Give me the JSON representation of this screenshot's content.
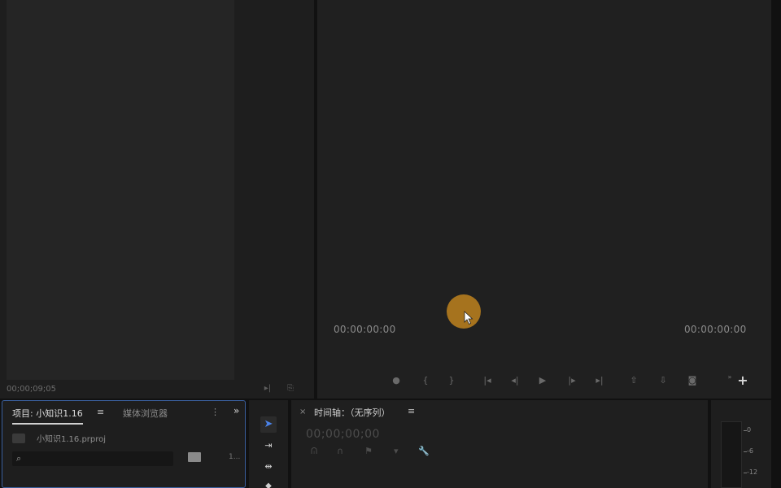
{
  "source_monitor": {
    "timecode": "00;00;09;05",
    "controls": [
      "export-frame-icon",
      "settings-icon"
    ]
  },
  "program_monitor": {
    "timecode_left": "00:00:00:00",
    "timecode_right": "00:00:00:00",
    "controls": [
      {
        "name": "add-marker-icon",
        "glyph": "●"
      },
      {
        "name": "mark-in-icon",
        "glyph": "{"
      },
      {
        "name": "mark-out-icon",
        "glyph": "}"
      },
      {
        "name": "go-to-in-icon",
        "glyph": "|◂"
      },
      {
        "name": "step-back-icon",
        "glyph": "◂|"
      },
      {
        "name": "play-icon",
        "glyph": "▶"
      },
      {
        "name": "step-forward-icon",
        "glyph": "|▸"
      },
      {
        "name": "go-to-out-icon",
        "glyph": "▸|"
      },
      {
        "name": "lift-icon",
        "glyph": "⇧"
      },
      {
        "name": "extract-icon",
        "glyph": "⇩"
      },
      {
        "name": "export-frame-icon",
        "glyph": "◙"
      }
    ],
    "more_label": "»",
    "add_label": "+"
  },
  "project_panel": {
    "tab_project": "项目: 小知识1.16",
    "tab_menu": "≡",
    "tab_media_browser": "媒体浏览器",
    "more": "⋮",
    "expand": "»",
    "file_name": "小知识1.16.prproj",
    "search_placeholder": "",
    "item_count": "1..."
  },
  "timeline_panel": {
    "close": "×",
    "title": "时间轴：（无序列）",
    "menu": "≡",
    "timecode": "00;00;00;00"
  },
  "audio_meter": {
    "labels": [
      "0",
      "-6",
      "-12"
    ]
  },
  "colors": {
    "accent_blue": "#3a5f9e",
    "cursor_highlight": "#be821e"
  }
}
